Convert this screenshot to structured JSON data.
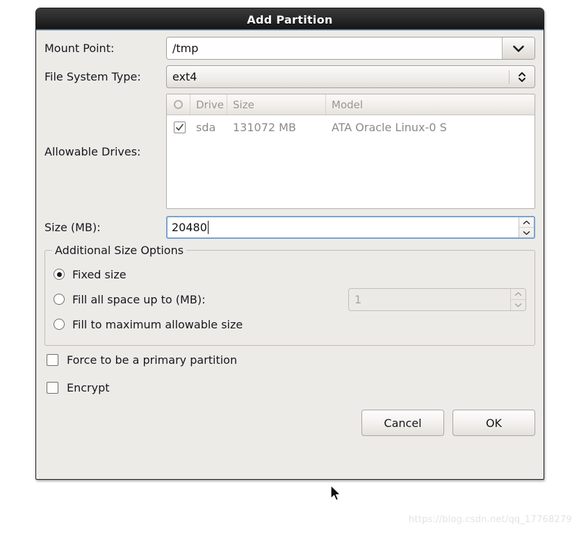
{
  "dialog": {
    "title": "Add Partition"
  },
  "mount_point": {
    "label": "Mount Point:",
    "value": "/tmp",
    "dropdown_icon": "chevron-down-icon"
  },
  "file_system_type": {
    "label": "File System Type:",
    "value": "ext4",
    "dropdown_icon": "chevron-up-down-icon"
  },
  "allowable_drives": {
    "label": "Allowable Drives:",
    "columns": [
      "",
      "Drive",
      "Size",
      "Model"
    ],
    "header_check_icon": "circle-icon",
    "rows": [
      {
        "checked": true,
        "drive": "sda",
        "size": "131072 MB",
        "model": "ATA Oracle Linux-0 S"
      }
    ]
  },
  "size": {
    "label": "Size (MB):",
    "value": "20480",
    "focused": true
  },
  "additional_size_options": {
    "title": "Additional Size Options",
    "options": [
      {
        "label": "Fixed size",
        "selected": true
      },
      {
        "label": "Fill all space up to (MB):",
        "selected": false
      },
      {
        "label": "Fill to maximum allowable size",
        "selected": false
      }
    ],
    "fill_up_to_value": "1",
    "fill_up_to_enabled": false
  },
  "checkboxes": [
    {
      "label": "Force to be a primary partition",
      "checked": false
    },
    {
      "label": "Encrypt",
      "checked": false
    }
  ],
  "buttons": {
    "cancel": "Cancel",
    "ok": "OK"
  },
  "watermark": "https://blog.csdn.net/qq_17768279",
  "colors": {
    "dialog_bg": "#edebe8",
    "titlebar": "#2c2c2c",
    "focus_border": "#7ba3cc",
    "title_accent": "#7d9ab6"
  }
}
